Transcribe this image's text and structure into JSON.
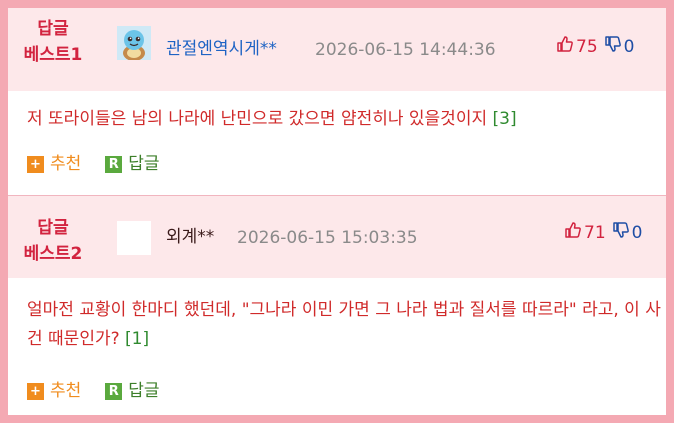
{
  "comments": [
    {
      "best_line1": "답글",
      "best_line2": "베스트1",
      "nickname": "관절엔역시게**",
      "datetime": "2026-06-15 14:44:36",
      "up_votes": "75",
      "down_votes": "0",
      "text": "저 또라이들은 남의 나라에 난민으로 갔으면 얌전히나 있을것이지",
      "reply_count": "[3]",
      "recommend_label": "추천",
      "reply_label": "답글",
      "avatar_icon": "squirtle-avatar-icon"
    },
    {
      "best_line1": "답글",
      "best_line2": "베스트2",
      "nickname": "외계**",
      "datetime": "2026-06-15 15:03:35",
      "up_votes": "71",
      "down_votes": "0",
      "text": "얼마전 교황이 한마디 했던데, \"그나라 이민 가면 그 나라 법과 질서를 따르라\" 라고, 이 사건 때문인가?",
      "reply_count": "[1]",
      "recommend_label": "추천",
      "reply_label": "답글",
      "avatar_icon": "blank-avatar"
    }
  ],
  "colors": {
    "best_red": "#d2233f",
    "nick_blue_1": "#1e63c4",
    "nick_dark_2": "#3a1a1a",
    "body_red": "#d02a2a",
    "header_bg": "#fde8ea",
    "frame_pink": "#f4a9b3",
    "recommend_orange": "#f08c1e",
    "reply_green": "#5aa93e"
  }
}
